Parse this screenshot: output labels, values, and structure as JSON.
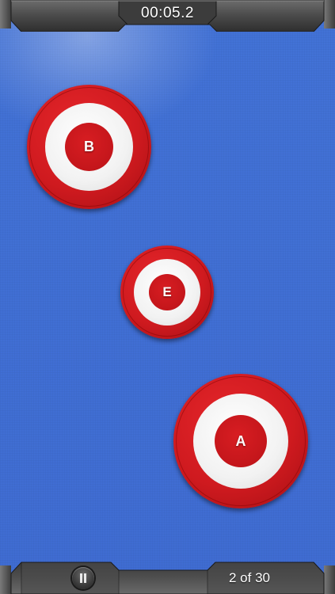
{
  "hud": {
    "timer": "00:05.2",
    "progress": "2 of 30"
  },
  "targets": [
    {
      "letter": "B"
    },
    {
      "letter": "E"
    },
    {
      "letter": "A"
    }
  ],
  "colors": {
    "background": "#3f6fd6",
    "target_red": "#d01a1f",
    "target_white": "#f4f4f4",
    "bar_metal": "#5a5a5a"
  },
  "icons": {
    "pause": "pause-icon"
  }
}
